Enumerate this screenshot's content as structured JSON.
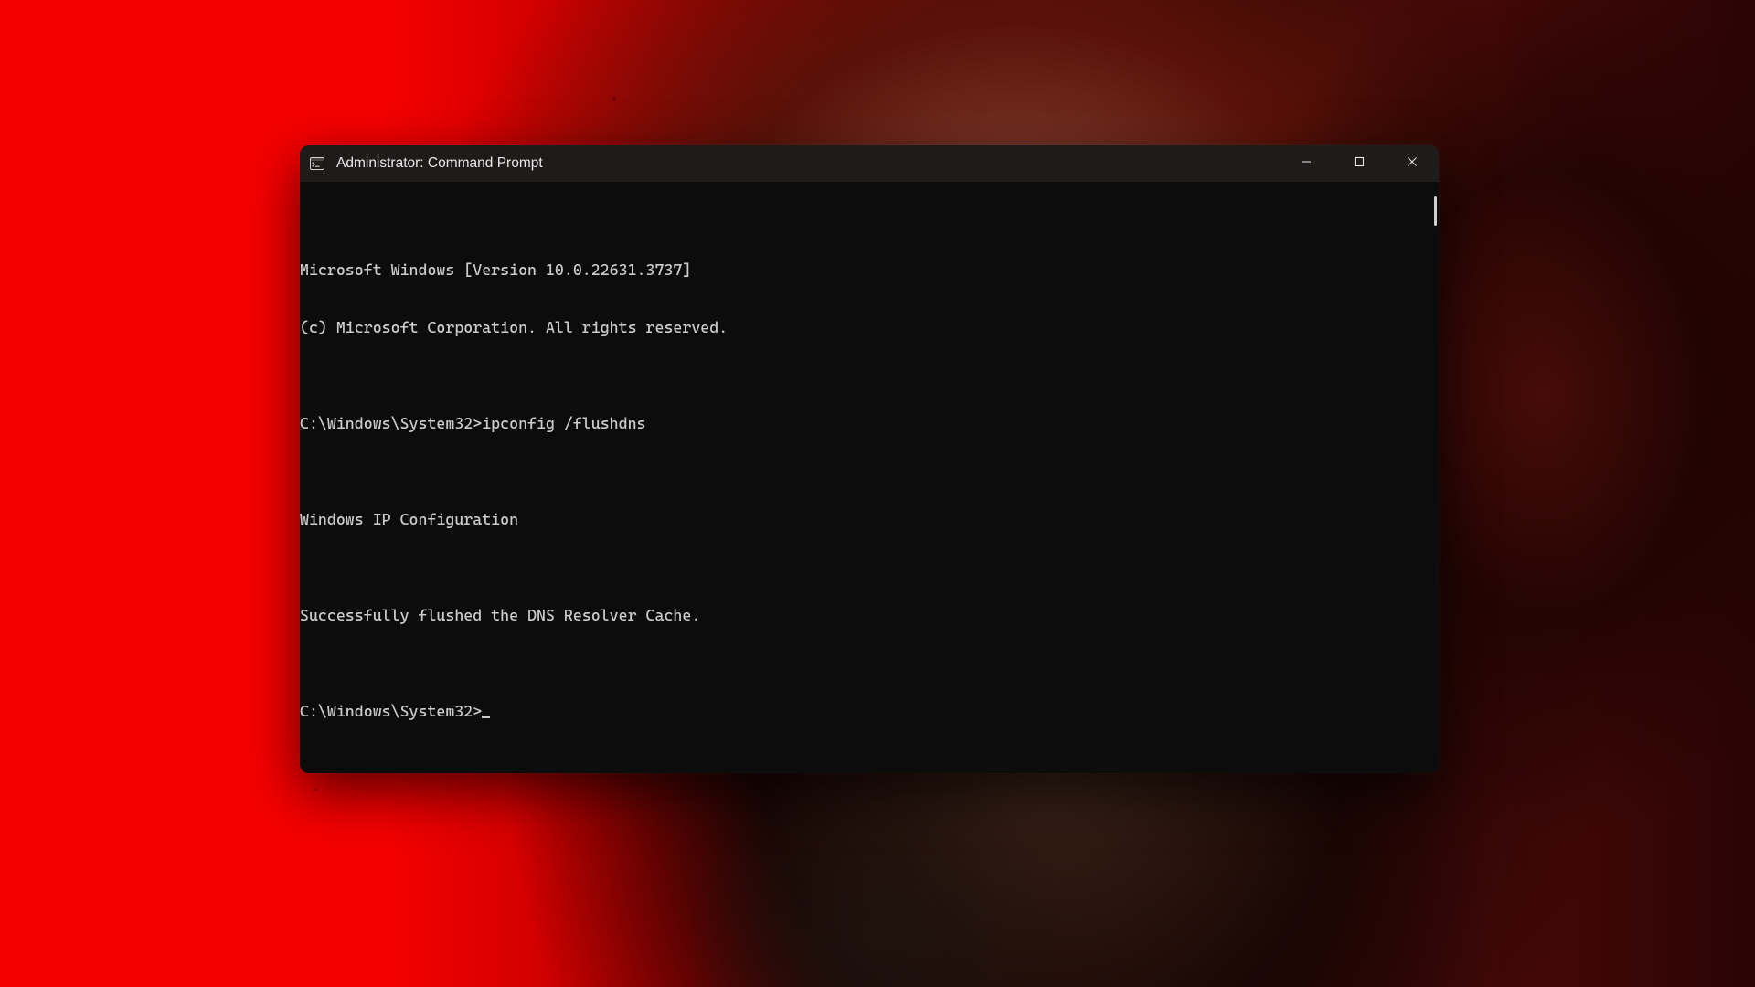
{
  "window": {
    "title": "Administrator: Command Prompt"
  },
  "terminal": {
    "lines": [
      "Microsoft Windows [Version 10.0.22631.3737]",
      "(c) Microsoft Corporation. All rights reserved.",
      "",
      "C:\\Windows\\System32>ipconfig /flushdns",
      "",
      "Windows IP Configuration",
      "",
      "Successfully flushed the DNS Resolver Cache.",
      ""
    ],
    "prompt": "C:\\Windows\\System32>"
  },
  "controls": {
    "minimize_tooltip": "Minimize",
    "maximize_tooltip": "Maximize",
    "close_tooltip": "Close"
  }
}
